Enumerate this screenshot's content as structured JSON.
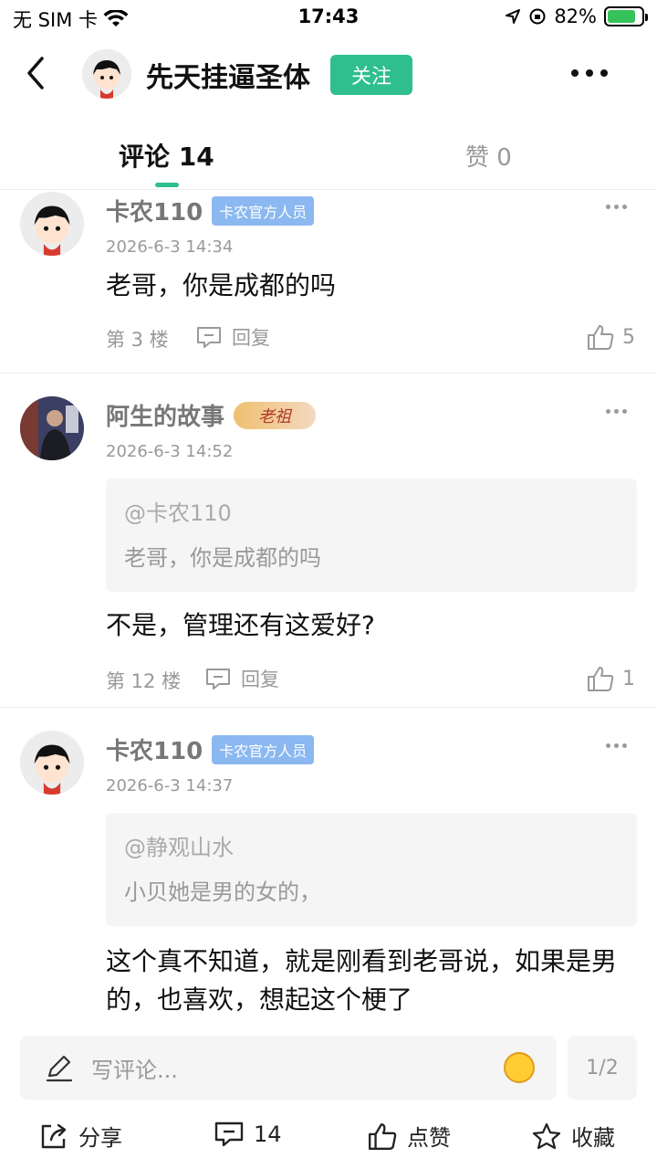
{
  "status": {
    "carrier": "无 SIM 卡",
    "time": "17:43",
    "battery": "82%",
    "battery_level": 0.82
  },
  "header": {
    "user_name": "先天挂逼圣体",
    "follow_label": "关注"
  },
  "tabs": {
    "comments_label": "评论 14",
    "likes_label": "赞 0"
  },
  "comments": [
    {
      "user": "卡农110",
      "badge": "卡农官方人员",
      "time": "2026-6-3 14:34",
      "text": "老哥，你是成都的吗",
      "floor": "第 3 楼",
      "reply_label": "回复",
      "likes": "5"
    },
    {
      "user": "阿生的故事",
      "badge": "老祖",
      "time": "2026-6-3 14:52",
      "quote_user": "@卡农110",
      "quote_text": "老哥，你是成都的吗",
      "text": "不是，管理还有这爱好?",
      "floor": "第 12 楼",
      "reply_label": "回复",
      "likes": "1"
    },
    {
      "user": "卡农110",
      "badge": "卡农官方人员",
      "time": "2026-6-3 14:37",
      "quote_user": "@静观山水",
      "quote_text": "小贝她是男的女的，",
      "text": "这个真不知道，就是刚看到老哥说，如果是男的，也喜欢，想起这个梗了"
    }
  ],
  "input": {
    "placeholder": "写评论...",
    "page_indicator": "1/2"
  },
  "bottom": {
    "share_label": "分享",
    "comment_count": "14",
    "like_label": "点赞",
    "favorite_label": "收藏"
  },
  "colors": {
    "accent": "#2fbf8e",
    "official_badge": "#8bb8f0"
  }
}
